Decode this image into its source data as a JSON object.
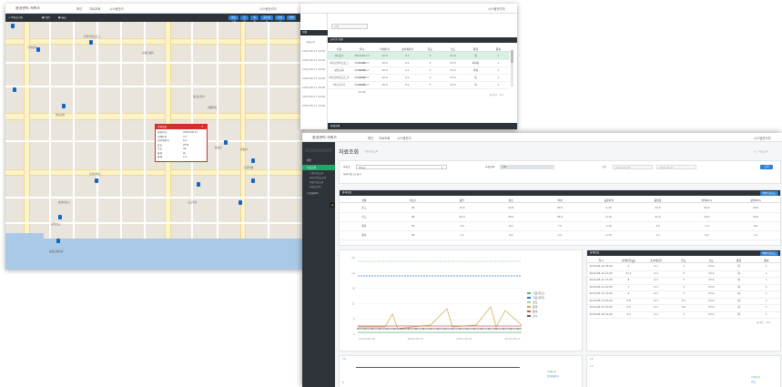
{
  "app": {
    "name": "환경관리 서비스",
    "menu": [
      "확인",
      "자료조회",
      "시스템관리"
    ],
    "user": "시스템관리자"
  },
  "map_window": {
    "toolbar_left": [
      "+ 하나로기지",
      "▣ 일반",
      "▣ 중요"
    ],
    "toolbar_buttons": [
      "새로고침",
      "조회",
      "측정",
      "공간정보",
      "측정기",
      "전체"
    ],
    "labels": [
      "한화라이프로그",
      "신라상가",
      "남동스퀘어",
      "호남프라자",
      "명도성당",
      "세종빌딩",
      "용호초",
      "원호사",
      "트윈타워",
      "한신아파트",
      "호남하모니",
      "구조빌딩",
      "장원초교",
      "평생교육회관"
    ],
    "popup": {
      "title": "관측정보",
      "rows": [
        {
          "k": "측정일시",
          "v": "2019-08-17"
        },
        {
          "k": "미세먼지",
          "v": "3.7"
        },
        {
          "k": "초미세먼지",
          "v": "0.1"
        },
        {
          "k": "온도",
          "v": "23.8"
        },
        {
          "k": "습도",
          "v": "42"
        },
        {
          "k": "풍향",
          "v": "북"
        },
        {
          "k": "풍속",
          "v": "1.2"
        }
      ]
    }
  },
  "table_window": {
    "left_title": "실황",
    "left_sub": "측정일시",
    "left_rows": [
      "2019-08-17 10:00",
      "2019-08-17 10:00",
      "2019-08-17 10:00",
      "2019-08-17 10:00",
      "2019-08-17 10:00",
      "2019-08-17 10:00",
      "2019-08-17 10:00"
    ],
    "search_placeholder": "검색",
    "panel_title": "공기질 현황",
    "columns": [
      "지점",
      "일시",
      "미세먼지",
      "초미세먼지",
      "온도",
      "습도",
      "풍향",
      "풍속"
    ],
    "rows": [
      [
        "하나로1",
        "2019-08-17 11:00",
        "10.0",
        "0.1",
        "3",
        "23.0",
        "북",
        "1"
      ],
      [
        "하나로라이프로그",
        "2019-08-17 10:00",
        "10.0",
        "0.1",
        "3",
        "23.0",
        "북북동",
        "1"
      ],
      [
        "평생교육",
        "2019-08-17 10:00",
        "10.0",
        "0.1",
        "3",
        "23.0",
        "북동",
        "1"
      ],
      [
        "하나로라이프로그2",
        "2019-08-17 10:00",
        "10.0",
        "0.1",
        "3",
        "23.0",
        "동",
        "1"
      ],
      [
        "하나로기지",
        "2019-08-17 10:00",
        "10.0",
        "0.1",
        "3",
        "23.0",
        "북",
        "1"
      ]
    ],
    "paging": "총 5건 · 1/1",
    "footer": "측정항목"
  },
  "dashboard": {
    "page_title": "자료조회",
    "page_sub": "기상자료조회",
    "breadcrumb": "홈 › 자료조회",
    "sidebar": [
      {
        "label": "메인",
        "active": false
      },
      {
        "label": "자료조회",
        "active": true
      },
      {
        "label": "기상자료조회",
        "active": false,
        "sub": true
      },
      {
        "label": "대기질자료조회",
        "active": false,
        "sub": true
      },
      {
        "label": "측정자료조회",
        "active": false,
        "sub": true
      },
      {
        "label": "측정소관리",
        "active": false,
        "sub": true
      },
      {
        "label": "시스템관리",
        "active": false
      }
    ],
    "filters": {
      "site_label": "측정소",
      "site_value": "하나로",
      "item_label": "측정항목",
      "item_value": "전체",
      "period_label": "기간",
      "date_from": "2019-08-08",
      "date_to": "2019-08-17",
      "checkbox_label": "측정자료 값 표시",
      "search_button": "조회"
    },
    "summary_panel": {
      "title": "통계정보",
      "button": "엑셀다운로드",
      "columns": [
        "항목",
        "자료수",
        "평균",
        "최소",
        "최대",
        "표준편차",
        "중앙값",
        "하위10%",
        "상위10%"
      ],
      "rows": [
        [
          "온도",
          "96",
          "23.8",
          "19.8",
          "29.5",
          "2.40",
          "23.6",
          "20.9",
          "26.9"
        ],
        [
          "습도",
          "96",
          "42.0",
          "30.0",
          "55.0",
          "6.10",
          "41.0",
          "34.0",
          "50.0"
        ],
        [
          "풍향",
          "96",
          "3.0",
          "0.0",
          "7.0",
          "2.10",
          "3.0",
          "1.0",
          "6.0"
        ],
        [
          "풍속",
          "96",
          "1.2",
          "0.0",
          "3.4",
          "0.70",
          "1.1",
          "0.4",
          "2.1"
        ]
      ]
    },
    "chart": {
      "type": "line",
      "x_labels": [
        "2019-08-08",
        "2019-08-11",
        "2019-08-14",
        "2019-08-17"
      ],
      "y_ticks": [
        "30",
        "24",
        "18",
        "12",
        "6",
        "0"
      ],
      "legend": [
        "기온(최고)",
        "기온(최저)",
        "습도",
        "풍향",
        "풍속",
        "강수"
      ],
      "legend_colors": [
        "#5ab66b",
        "#2b7bd3",
        "#9ed3a8",
        "#c8a93e",
        "#d9534f",
        "#555555"
      ]
    },
    "detail_panel": {
      "title": "상세정보",
      "button": "엑셀다운로드",
      "columns": [
        "일시",
        "미세먼지(㎍)",
        "초미세먼지",
        "온도",
        "습도",
        "풍향",
        "풍속"
      ],
      "rows": [
        [
          "2019-08-10 09:00",
          "4",
          "0.1",
          "3",
          "23.0",
          "북",
          "1"
        ],
        [
          "2019-08-10 11:00",
          "11.2",
          "0.1",
          "3",
          "23.0",
          "북",
          "1"
        ],
        [
          "2019-08-11 10:00",
          "8",
          "0.1",
          "3",
          "23.0",
          "북",
          "1"
        ],
        [
          "2019-08-12 10:00",
          "7",
          "0.1",
          "3",
          "23.0",
          "북",
          "1"
        ],
        [
          "2019-08-13 10:00",
          "9",
          "0.1",
          "3",
          "23.0",
          "북",
          "1"
        ],
        [
          "2019-08-14 10:00",
          "0.8",
          "0.1",
          "0.1",
          "23.0",
          "북",
          "1"
        ],
        [
          "2019-08-15 10:00",
          "4.6",
          "0.1",
          "0.5",
          "23.0",
          "북",
          "1"
        ],
        [
          "2019-08-16 10:00",
          "3.4",
          "0.1",
          "3",
          "23.0",
          "북",
          "1"
        ]
      ],
      "paging": "총 8건 · 1/1"
    },
    "bottom_chart": {
      "y_ticks": [
        "10",
        "5"
      ]
    },
    "bottom_chart2": {
      "y_ticks": [
        "12",
        "10"
      ]
    },
    "bottom_legend": [
      "미세먼지",
      "초미세먼지",
      "온도"
    ]
  }
}
